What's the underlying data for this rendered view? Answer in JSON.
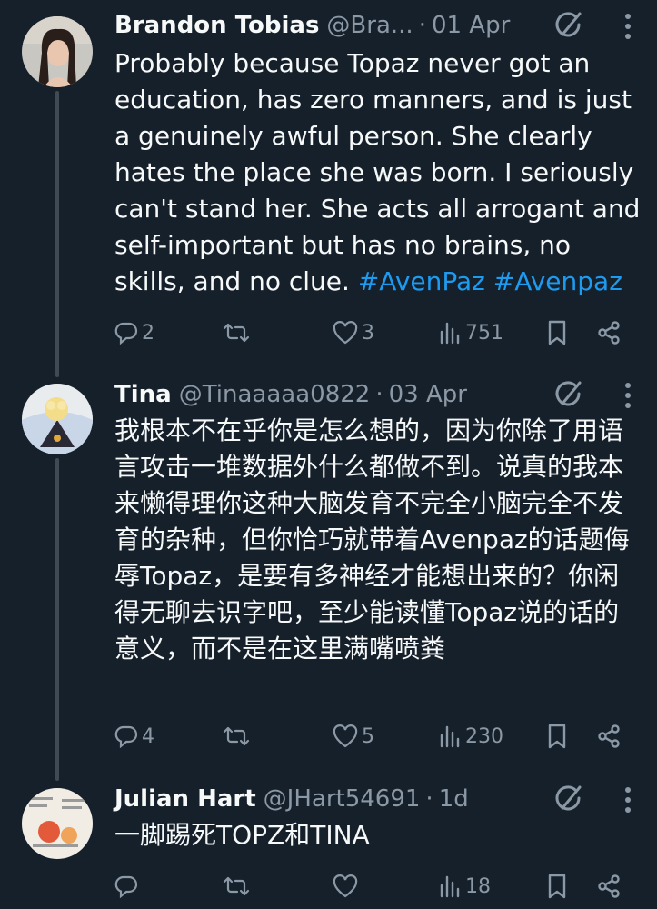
{
  "tweets": [
    {
      "name": "Brandon Tobias",
      "handle": "@Bra...",
      "time": "01 Apr",
      "text_main": "Probably because Topaz never got an education, has zero manners, and is just a genuinely awful person. She clearly hates the place she was born. I seriously can't stand her. She acts all arrogant and self-important but has no brains, no skills, and no clue. ",
      "hashtag1": "#AvenPaz",
      "hashtag2": "#Avenpaz",
      "replies": "2",
      "reposts": "",
      "likes": "3",
      "views": "751"
    },
    {
      "name": "Tina",
      "handle": "@Tinaaaaa0822",
      "time": "03 Apr",
      "text_main": "我根本不在乎你是怎么想的，因为你除了用语言攻击一堆数据外什么都做不到。说真的我本来懒得理你这种大脑发育不完全小脑完全不发育的杂种，但你恰巧就带着Avenpaz的话题侮辱Topaz，是要有多神经才能想出来的？你闲得无聊去识字吧，至少能读懂Topaz说的话的意义，而不是在这里满嘴喷粪",
      "replies": "4",
      "reposts": "",
      "likes": "5",
      "views": "230"
    },
    {
      "name": "Julian Hart",
      "handle": "@JHart54691",
      "time": "1d",
      "text_main": "一脚踢死TOPZ和TINA",
      "replies": "",
      "reposts": "",
      "likes": "",
      "views": "18"
    }
  ],
  "icons": {
    "reply": "reply-icon",
    "repost": "repost-icon",
    "like": "heart-icon",
    "views": "views-icon",
    "bookmark": "bookmark-icon",
    "share": "share-icon",
    "grok": "grok-icon",
    "more": "more-icon"
  },
  "colors": {
    "background": "#15202b",
    "text": "#f7f9f9",
    "muted": "#8b98a5",
    "link": "#1d9bf0",
    "thread_line": "#3f4a55"
  }
}
